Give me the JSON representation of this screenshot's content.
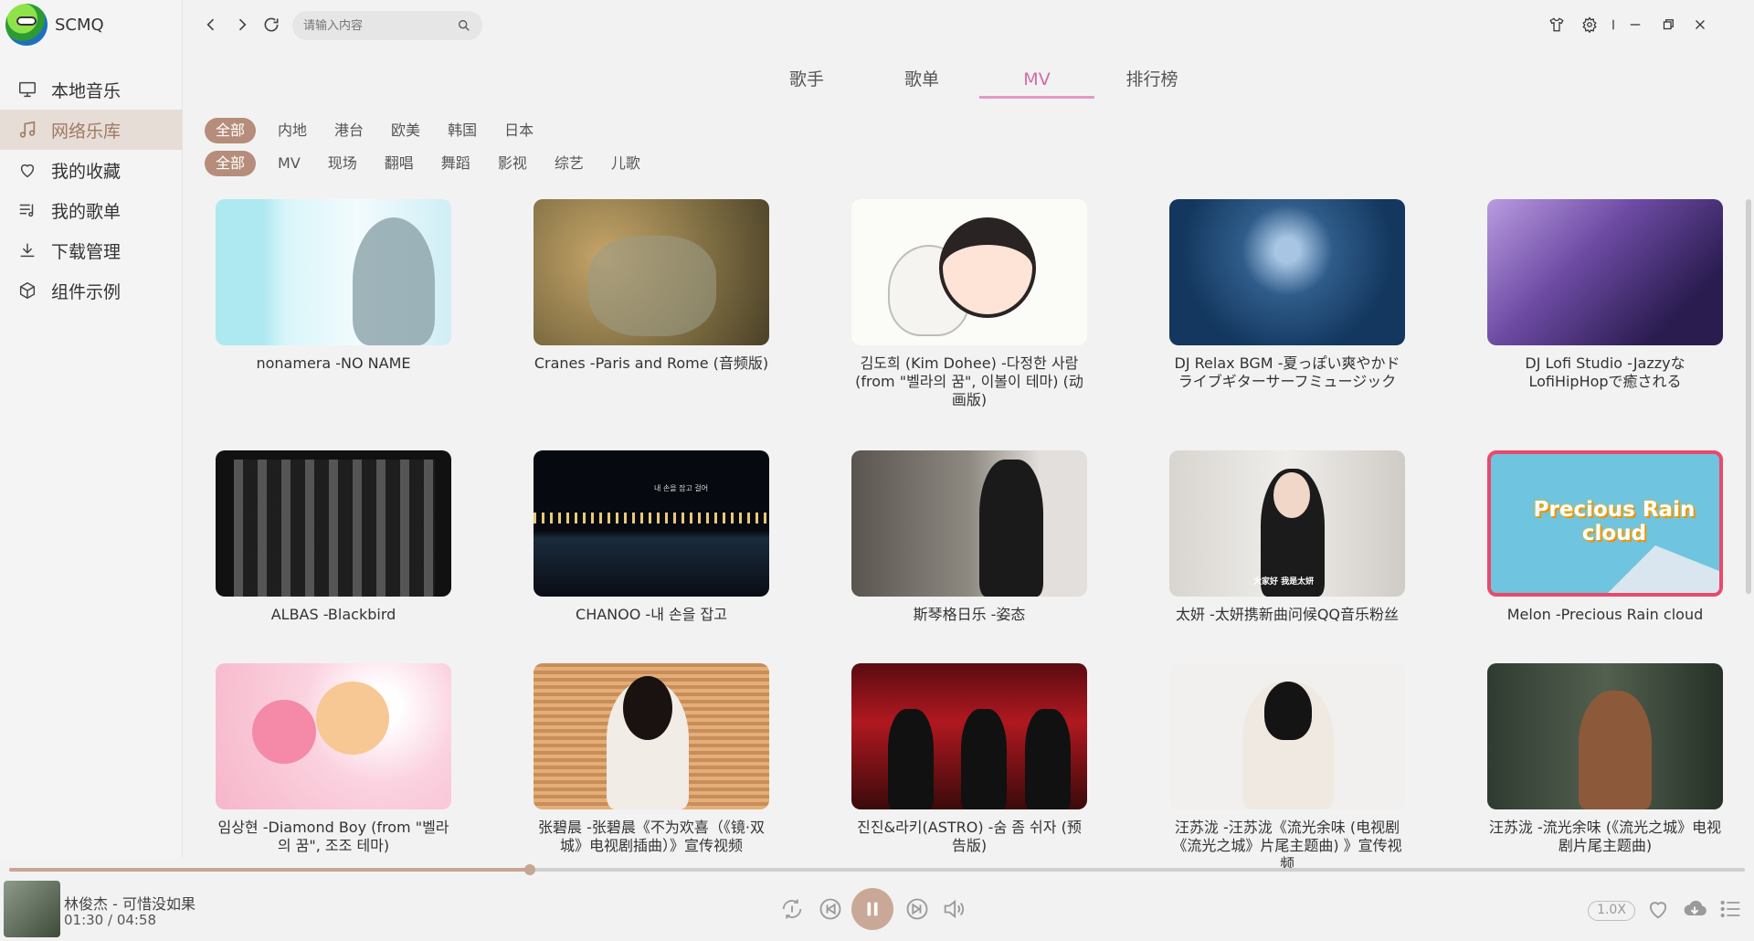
{
  "app": {
    "name": "SCMQ"
  },
  "sidebar": {
    "items": [
      {
        "label": "本地音乐",
        "icon": "monitor-icon",
        "active": false
      },
      {
        "label": "网络乐库",
        "icon": "music-note-icon",
        "active": true
      },
      {
        "label": "我的收藏",
        "icon": "heart-icon",
        "active": false
      },
      {
        "label": "我的歌单",
        "icon": "playlist-icon",
        "active": false
      },
      {
        "label": "下载管理",
        "icon": "download-icon",
        "active": false
      },
      {
        "label": "组件示例",
        "icon": "cube-icon",
        "active": false
      }
    ]
  },
  "search": {
    "placeholder": "请输入内容"
  },
  "tabs": [
    {
      "label": "歌手",
      "active": false
    },
    {
      "label": "歌单",
      "active": false
    },
    {
      "label": "MV",
      "active": true
    },
    {
      "label": "排行榜",
      "active": false
    }
  ],
  "filters": {
    "region": [
      "全部",
      "内地",
      "港台",
      "欧美",
      "韩国",
      "日本"
    ],
    "type": [
      "全部",
      "MV",
      "现场",
      "翻唱",
      "舞蹈",
      "影视",
      "综艺",
      "儿歌"
    ]
  },
  "mvs": [
    {
      "title": "nonamera -NO NAME"
    },
    {
      "title": "Cranes -Paris and Rome (音频版)"
    },
    {
      "title": "김도희 (Kim Dohee) -다정한 사람 (from \"벨라의 꿈\", 이볼이 테마) (动画版)"
    },
    {
      "title": "DJ Relax BGM -夏っぽい爽やかドライブギターサーフミュージック"
    },
    {
      "title": "DJ Lofi Studio -Jazzyな LofiHipHopで癒される"
    },
    {
      "title": "ALBAS -Blackbird"
    },
    {
      "title": "CHANOO -내 손을 잡고"
    },
    {
      "title": "斯琴格日乐 -姿态"
    },
    {
      "title": "太妍 -太妍携新曲问候QQ音乐粉丝"
    },
    {
      "title": "Melon -Precious Rain cloud"
    },
    {
      "title": "임상현 -Diamond Boy (from \"벨라의 꿈\", 조조 테마)"
    },
    {
      "title": "张碧晨 -张碧晨《不为欢喜（《镜·双城》电视剧插曲）》宣传视频"
    },
    {
      "title": "진진&라키(ASTRO) -숨 좀 쉬자 (预告版)"
    },
    {
      "title": "汪苏泷 -汪苏泷《流光余味 (电视剧《流光之城》片尾主题曲) 》宣传视频"
    },
    {
      "title": "汪苏泷 -流光余味 (《流光之城》电视剧片尾主题曲)"
    }
  ],
  "thumb_text": {
    "t6": "내 손을 잡고 걸어",
    "t8": "大家好 我是太妍",
    "t9": "Precious Rain cloud"
  },
  "player": {
    "song": "林俊杰  -  可惜没如果",
    "time": "01:30 / 04:58",
    "progress": 0.3,
    "speed": "1.0X"
  },
  "colors": {
    "accent": "#c6a693",
    "active_tab": "#d26ba8",
    "chip_active": "#b58d7a"
  }
}
